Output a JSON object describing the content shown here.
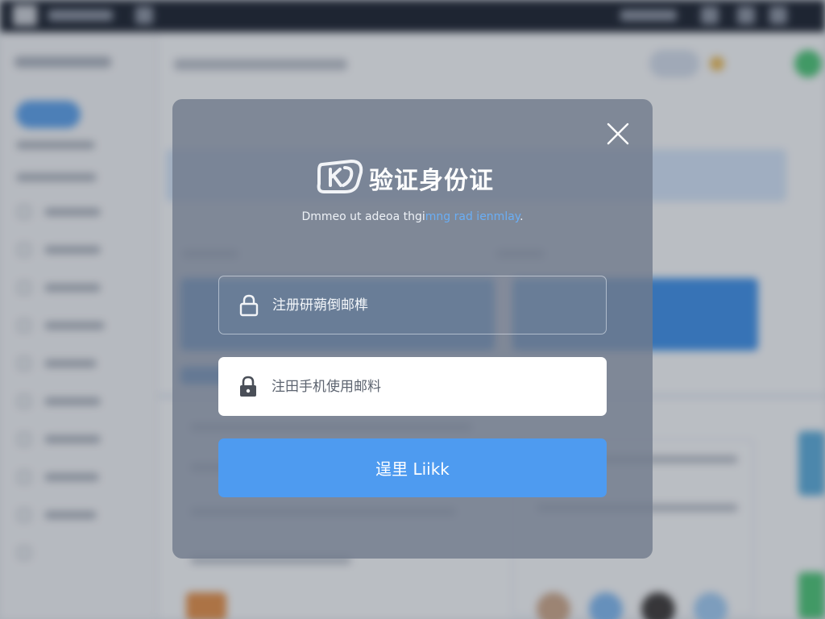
{
  "modal": {
    "title": "验证身份证",
    "subtitle_text": "Dmmeo ut adeoa  thgi",
    "subtitle_link": "mng rad ienmlay",
    "subtitle_end": ".",
    "field_1": {
      "placeholder": "注册研蒴倒邮榫"
    },
    "field_2": {
      "placeholder": "注田手机使用邮料"
    },
    "submit_label": "逞里 Liikk"
  },
  "colors": {
    "accent": "#4e9bf0",
    "link": "#6aaef5",
    "modal_bg": "#707a8c",
    "topbar": "#1b2230"
  },
  "icons": [
    "logo-icon",
    "close-icon",
    "lock-icon"
  ]
}
